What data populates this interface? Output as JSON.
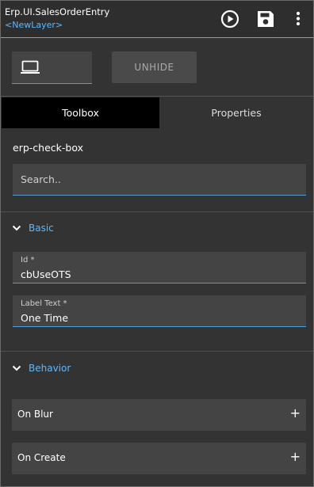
{
  "header": {
    "app_title": "Erp.UI.SalesOrderEntry",
    "layer_name": "<NewLayer>",
    "icons": [
      "play-circle-icon",
      "save-icon",
      "more-vertical-icon"
    ]
  },
  "toolbar": {
    "device_icon": "laptop-icon",
    "unhide_label": "UNHIDE"
  },
  "tabs": [
    {
      "label": "Toolbox",
      "active": true
    },
    {
      "label": "Properties",
      "active": false
    }
  ],
  "component": {
    "name": "erp-check-box"
  },
  "search": {
    "placeholder": "Search.."
  },
  "sections": {
    "basic": {
      "title": "Basic",
      "fields": [
        {
          "label": "Id *",
          "value": "cbUseOTS"
        },
        {
          "label": "Label Text *",
          "value": "One Time"
        }
      ]
    },
    "behavior": {
      "title": "Behavior",
      "events": [
        {
          "label": "On Blur",
          "action": "+"
        },
        {
          "label": "On Create",
          "action": "+"
        }
      ]
    }
  },
  "colors": {
    "background": "#333333",
    "accent": "#5db8ff",
    "field_bg": "#444444",
    "active_tab": "#000000"
  }
}
